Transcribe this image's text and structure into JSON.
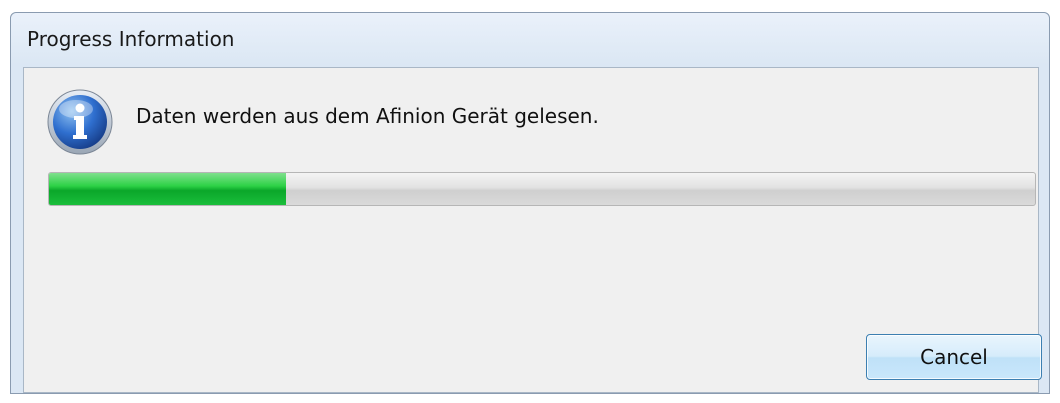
{
  "window": {
    "title": "Progress Information"
  },
  "dialog": {
    "icon": "info-icon",
    "message": "Daten werden aus dem Afinion Gerät gelesen.",
    "progress": {
      "fraction": 0.24,
      "fill_color": "#16c33a"
    },
    "cancel_label": "Cancel"
  }
}
